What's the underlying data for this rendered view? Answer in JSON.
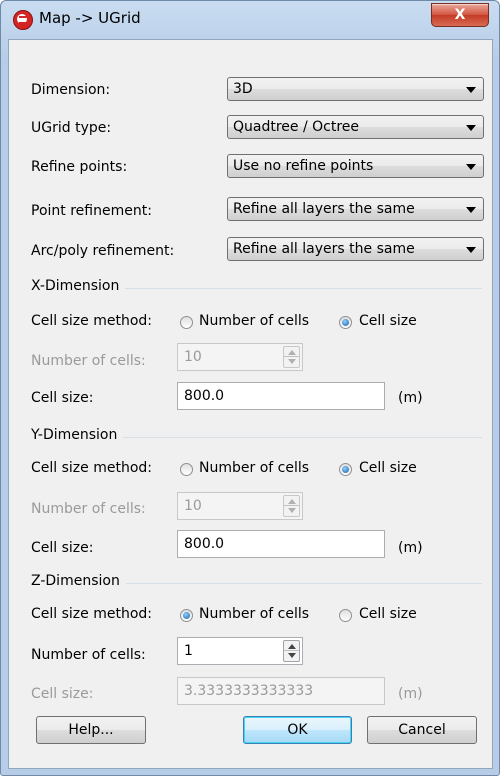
{
  "window": {
    "title": "Map -> UGrid",
    "close_label": "X"
  },
  "fields": {
    "dimension": {
      "label": "Dimension:",
      "value": "3D"
    },
    "ugrid_type": {
      "label": "UGrid type:",
      "value": "Quadtree / Octree"
    },
    "refine_points": {
      "label": "Refine points:",
      "value": "Use no refine points"
    },
    "point_refinement": {
      "label": "Point refinement:",
      "value": "Refine all layers the same"
    },
    "arc_poly_refinement": {
      "label": "Arc/poly refinement:",
      "value": "Refine all layers the same"
    }
  },
  "x_dimension": {
    "title": "X-Dimension",
    "method_label": "Cell size method:",
    "option_num_cells": "Number of cells",
    "option_cell_size": "Cell size",
    "selected": "cell_size",
    "num_cells_label": "Number of cells:",
    "num_cells_value": "10",
    "cell_size_label": "Cell size:",
    "cell_size_value": "800.0",
    "unit": "(m)"
  },
  "y_dimension": {
    "title": "Y-Dimension",
    "method_label": "Cell size method:",
    "option_num_cells": "Number of cells",
    "option_cell_size": "Cell size",
    "selected": "cell_size",
    "num_cells_label": "Number of cells:",
    "num_cells_value": "10",
    "cell_size_label": "Cell size:",
    "cell_size_value": "800.0",
    "unit": "(m)"
  },
  "z_dimension": {
    "title": "Z-Dimension",
    "method_label": "Cell size method:",
    "option_num_cells": "Number of cells",
    "option_cell_size": "Cell size",
    "selected": "num_cells",
    "num_cells_label": "Number of cells:",
    "num_cells_value": "1",
    "cell_size_label": "Cell size:",
    "cell_size_value": "3.3333333333333",
    "unit": "(m)"
  },
  "buttons": {
    "help": "Help...",
    "ok": "OK",
    "cancel": "Cancel"
  },
  "colors": {
    "titlebar": "#b7cde7",
    "close_button": "#c43b24",
    "client_bg": "#f0f0f0",
    "default_button_border": "#3c7fb1"
  }
}
